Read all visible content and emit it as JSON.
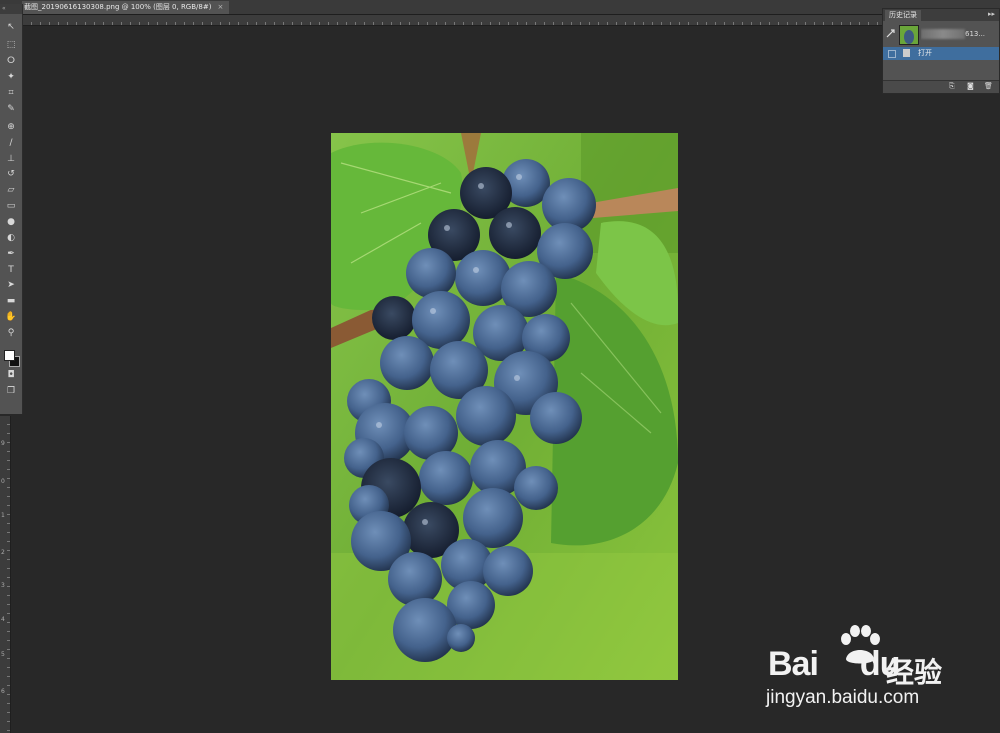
{
  "document_tab": {
    "title": "截图_20190616130308.png @ 100% (图层 0, RGB/8#)",
    "close_label": "×"
  },
  "toolbox": {
    "collapse_label": "«",
    "tools": [
      {
        "name": "move-tool",
        "glyph": "↖"
      },
      {
        "name": "marquee-tool",
        "glyph": "⬚"
      },
      {
        "name": "lasso-tool",
        "glyph": "ⵔ"
      },
      {
        "name": "quick-select-tool",
        "glyph": "✦"
      },
      {
        "name": "crop-tool",
        "glyph": "⌗"
      },
      {
        "name": "eyedropper-tool",
        "glyph": "✎"
      },
      {
        "name": "healing-tool",
        "glyph": "⊕"
      },
      {
        "name": "brush-tool",
        "glyph": "∕"
      },
      {
        "name": "stamp-tool",
        "glyph": "⊥"
      },
      {
        "name": "history-brush-tool",
        "glyph": "↺"
      },
      {
        "name": "eraser-tool",
        "glyph": "▱"
      },
      {
        "name": "gradient-tool",
        "glyph": "▭"
      },
      {
        "name": "blur-tool",
        "glyph": "●"
      },
      {
        "name": "dodge-tool",
        "glyph": "◐"
      },
      {
        "name": "pen-tool",
        "glyph": "✒"
      },
      {
        "name": "type-tool",
        "glyph": "T"
      },
      {
        "name": "path-select-tool",
        "glyph": "➤"
      },
      {
        "name": "shape-tool",
        "glyph": "▬"
      },
      {
        "name": "hand-tool",
        "glyph": "✋"
      },
      {
        "name": "zoom-tool",
        "glyph": "⚲"
      }
    ],
    "mode_glyphs": [
      "◘",
      "❐"
    ]
  },
  "left_ruler_labels": [
    "9",
    "0",
    "1",
    "2",
    "3",
    "4",
    "5",
    "6"
  ],
  "history_panel": {
    "title": "历史记录",
    "menu_glyph": "▸▸",
    "snapshot_name": "613...",
    "step_label": "打开",
    "footer_glyphs": [
      "⎘",
      "◙",
      "🗑"
    ]
  },
  "watermark": {
    "brand": "Bai",
    "brand_suffix": "du",
    "cn_text": "经验",
    "url": "jingyan.baidu.com"
  }
}
